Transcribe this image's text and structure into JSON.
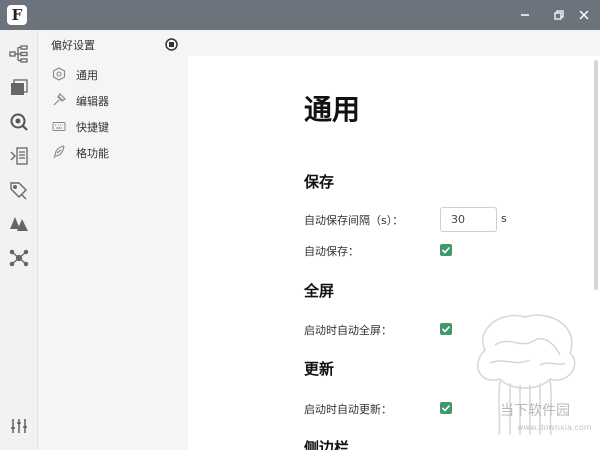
{
  "titlebar": {
    "logo_letter": "F",
    "icons": [
      "app-logo",
      "minimize-icon",
      "restore-icon",
      "close-icon"
    ]
  },
  "leftbar": {
    "icons": [
      "outline-tree-icon",
      "files-icon",
      "search-icon",
      "outline-list-icon",
      "tags-icon",
      "graph-icon",
      "network-icon",
      "settings-sliders-icon"
    ]
  },
  "settings_nav": {
    "title": "偏好设置",
    "items": [
      {
        "label": "通用",
        "icon": "general-icon"
      },
      {
        "label": "编辑器",
        "icon": "editor-icon"
      },
      {
        "label": "快捷键",
        "icon": "keyboard-icon"
      },
      {
        "label": "格功能",
        "icon": "feather-icon"
      }
    ]
  },
  "main": {
    "title": "通用",
    "sections": {
      "save": {
        "heading": "保存",
        "interval_label": "自动保存间隔（s）：",
        "interval_value": "30",
        "interval_unit": "s",
        "autosave_label": "自动保存："
      },
      "fullscreen": {
        "heading": "全屏",
        "startup_fullscreen_label": "启动时自动全屏："
      },
      "update": {
        "heading": "更新",
        "startup_update_label": "启动时自动更新："
      },
      "sidebar": {
        "heading": "侧边栏"
      }
    }
  },
  "watermark": {
    "text": "当下软件园",
    "url": "www.downxia.com"
  },
  "colors": {
    "titlebar": "#6b737c",
    "checkbox": "#3d9b6a",
    "sidebar_bg": "#f2f2f2",
    "nav_bg": "#f5f5f5"
  }
}
